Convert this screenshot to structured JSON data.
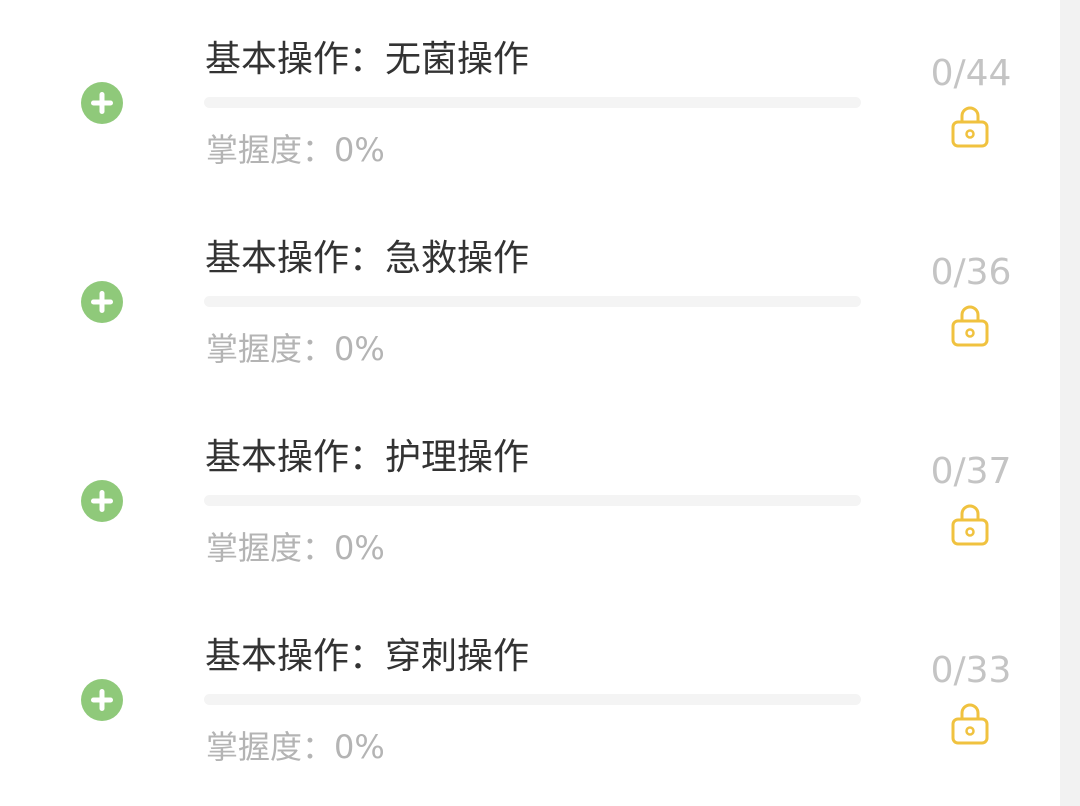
{
  "colors": {
    "plus_green": "#8fc97a",
    "lock_yellow": "#f0c23f",
    "title_text": "#333333",
    "sub_text": "#b4b4b4",
    "count_text": "#c4c4c4",
    "track": "#f4f4f4"
  },
  "chapters": [
    {
      "title": "基本操作：无菌操作",
      "mastery_label": "掌握度：",
      "mastery_value": "0%",
      "mastery_fraction": 0,
      "count": "0/44",
      "expand_icon": "plus-circle-icon",
      "status_icon": "lock-icon"
    },
    {
      "title": "基本操作：急救操作",
      "mastery_label": "掌握度：",
      "mastery_value": "0%",
      "mastery_fraction": 0,
      "count": "0/36",
      "expand_icon": "plus-circle-icon",
      "status_icon": "lock-icon"
    },
    {
      "title": "基本操作：护理操作",
      "mastery_label": "掌握度：",
      "mastery_value": "0%",
      "mastery_fraction": 0,
      "count": "0/37",
      "expand_icon": "plus-circle-icon",
      "status_icon": "lock-icon"
    },
    {
      "title": "基本操作：穿刺操作",
      "mastery_label": "掌握度：",
      "mastery_value": "0%",
      "mastery_fraction": 0,
      "count": "0/33",
      "expand_icon": "plus-circle-icon",
      "status_icon": "lock-icon"
    }
  ]
}
